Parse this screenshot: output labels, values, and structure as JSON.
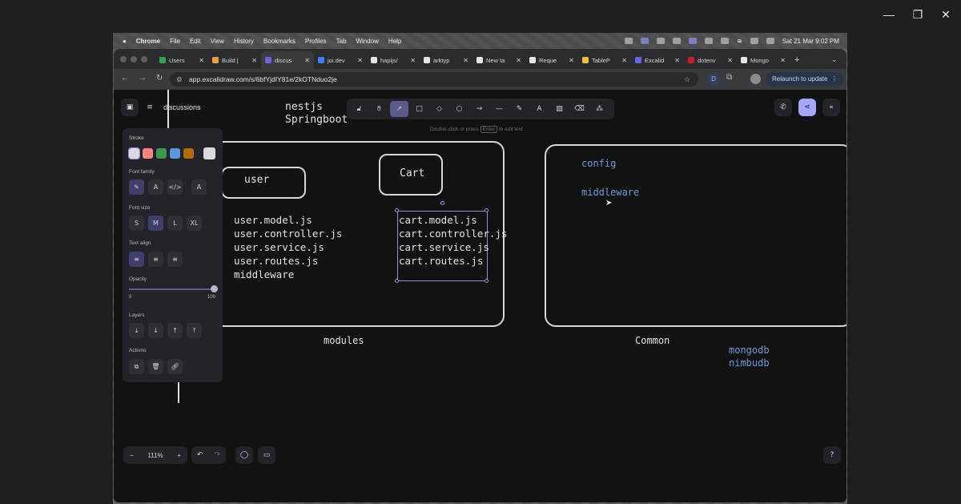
{
  "window_controls": {
    "minimize": "—",
    "restore": "❐",
    "close": "✕"
  },
  "menubar": {
    "app": "Chrome",
    "items": [
      "File",
      "Edit",
      "View",
      "History",
      "Bookmarks",
      "Profiles",
      "Tab",
      "Window",
      "Help"
    ],
    "clock": "Sat 21 Mar  9:02 PM"
  },
  "tabs": [
    {
      "label": "Users",
      "color": "#2ea44f"
    },
    {
      "label": "Build |",
      "color": "#f29d38"
    },
    {
      "label": "discus",
      "color": "#6965db",
      "active": true
    },
    {
      "label": "joi.dev",
      "color": "#3b82f6"
    },
    {
      "label": "hapijs/",
      "color": "#e5e5e5"
    },
    {
      "label": "arktyp",
      "color": "#e5e5e5"
    },
    {
      "label": "New ta",
      "color": "#e5e5e5"
    },
    {
      "label": "Reque",
      "color": "#e5e5e5"
    },
    {
      "label": "TableP",
      "color": "#f2c037"
    },
    {
      "label": "Excalid",
      "color": "#6965db"
    },
    {
      "label": "dotenv",
      "color": "#c21f2e"
    },
    {
      "label": "Mongo",
      "color": "#e5e5e5"
    }
  ],
  "address": {
    "url": "app.excalidraw.com/s/6bfYjdIY81e/2kOTNduo2je",
    "relaunch_label": "Relaunch to update",
    "profile_letter": "D"
  },
  "excalidraw": {
    "doc_name": "discussions",
    "hint_pre": "Double-click or press",
    "hint_key": "Enter",
    "hint_post": "to edit text",
    "zoom": "111%",
    "panel": {
      "stroke_label": "Stroke",
      "stroke_colors": [
        "#d9d9de",
        "#ff8383",
        "#3a994c",
        "#5b97de",
        "#b36b0c"
      ],
      "stroke_selected_color": "#d9d9de",
      "font_family_label": "Font family",
      "font_size_label": "Font size",
      "font_sizes": [
        "S",
        "M",
        "L",
        "XL"
      ],
      "text_align_label": "Text align",
      "opacity_label": "Opacity",
      "opacity_min": "0",
      "opacity_max": "100",
      "opacity_value": 100,
      "layers_label": "Layers",
      "actions_label": "Actions"
    },
    "drawing": {
      "title_lines": [
        "nestjs",
        "Springboot"
      ],
      "user_box": "user",
      "cart_box": "Cart",
      "user_files": [
        "user.model.js",
        "user.controller.js",
        "user.service.js",
        "user.routes.js",
        "middleware"
      ],
      "cart_files": [
        "cart.model.js",
        "cart.controller.js",
        "cart.service.js",
        "cart.routes.js"
      ],
      "modules_label": "modules",
      "common_items": [
        "config",
        "middleware"
      ],
      "common_label": "Common",
      "db_lines": [
        "mongodb",
        "nimbudb"
      ]
    }
  }
}
